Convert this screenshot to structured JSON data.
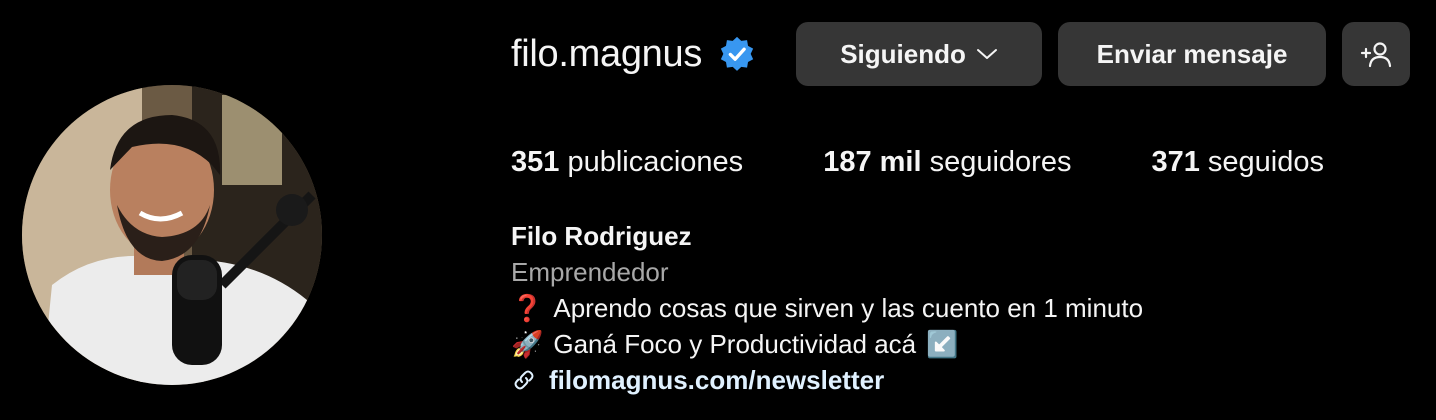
{
  "profile": {
    "username": "filo.magnus",
    "verified_icon": "verified-badge-icon",
    "avatar_icon": "profile-photo"
  },
  "actions": {
    "following_label": "Siguiendo",
    "message_label": "Enviar mensaje",
    "add_user_icon": "add-user-icon"
  },
  "stats": {
    "posts_count": "351",
    "posts_label": "publicaciones",
    "followers_count": "187 mil",
    "followers_label": "seguidores",
    "following_count": "371",
    "following_label": "seguidos"
  },
  "bio": {
    "full_name": "Filo Rodriguez",
    "category": "Emprendedor",
    "line1_emoji": "❓",
    "line1_text": "Aprendo cosas que sirven y las cuento en 1 minuto",
    "line2_emoji": "🚀",
    "line2_text": "Ganá Foco y Productividad acá",
    "line2_trailing_emoji": "↙️",
    "link_text": "filomagnus.com/newsletter"
  },
  "colors": {
    "background": "#000000",
    "button_bg": "#363636",
    "verified_blue": "#3897f0",
    "secondary_text": "#a8a8a8",
    "link_text": "#e0f1ff"
  }
}
